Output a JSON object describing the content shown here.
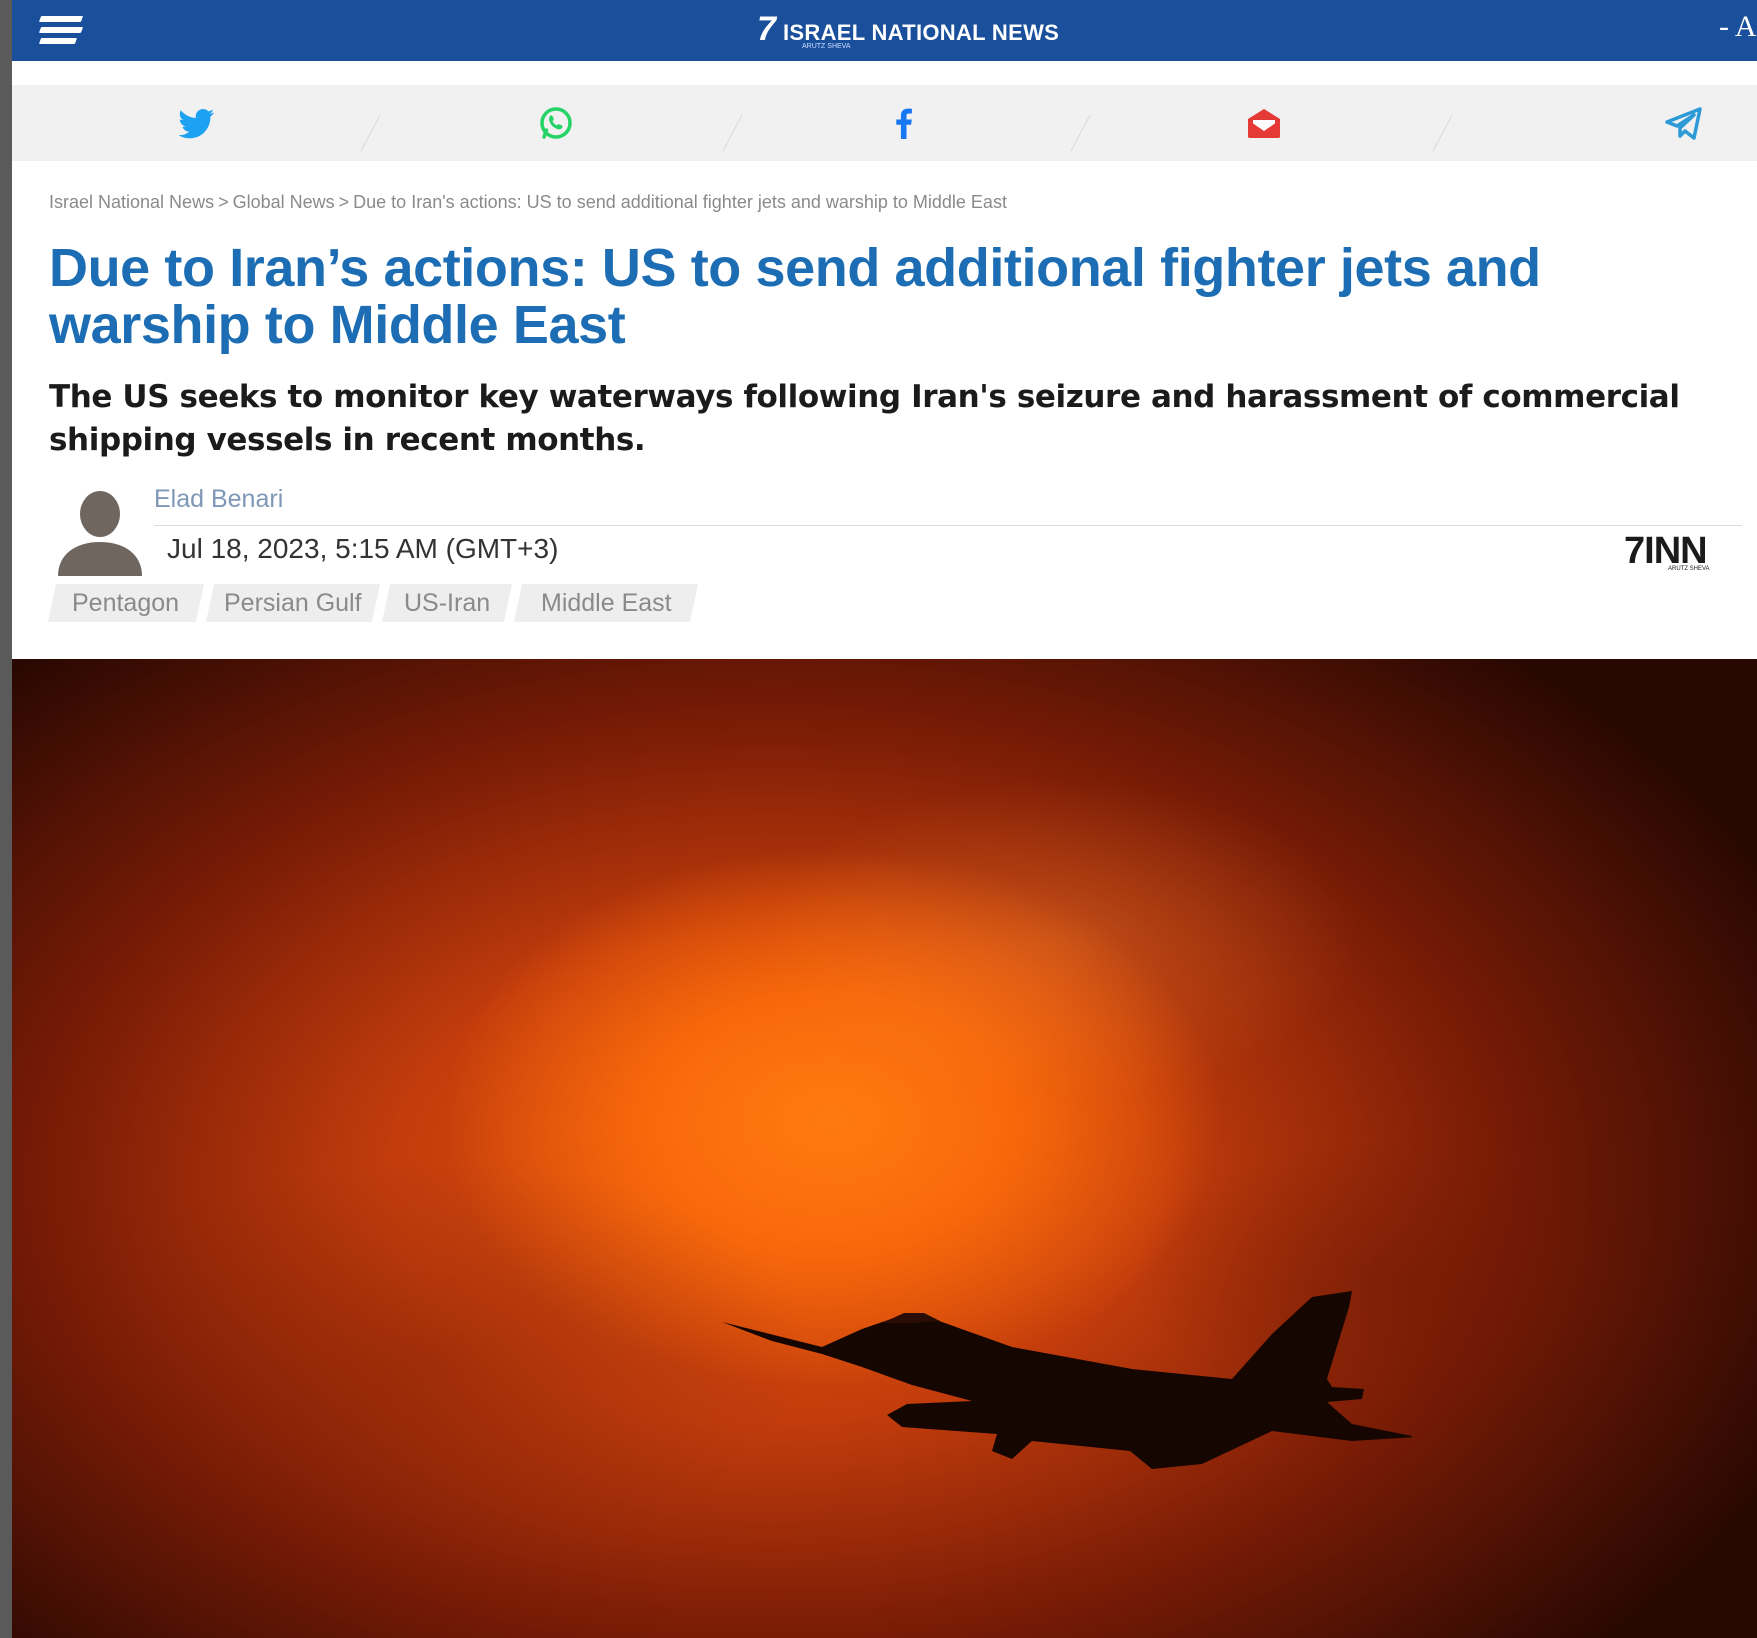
{
  "header": {
    "logo_mark": "7",
    "logo_text": "ISRAEL NATIONAL NEWS",
    "logo_subtext": "ARUTZ SHEVA",
    "font_size_control": "- A",
    "bar_color": "#1a4f9c"
  },
  "share": {
    "items": [
      {
        "name": "twitter-icon",
        "color": "#1da1f2"
      },
      {
        "name": "whatsapp-icon",
        "color": "#25d366"
      },
      {
        "name": "facebook-icon",
        "color": "#1877f2"
      },
      {
        "name": "email-icon",
        "color": "#e53935"
      },
      {
        "name": "telegram-icon",
        "color": "#2d9ad8"
      }
    ]
  },
  "breadcrumb": {
    "items": [
      "Israel National News",
      "Global News",
      "Due to Iran's actions: US to send additional fighter jets and warship to Middle East"
    ],
    "separator": ">"
  },
  "article": {
    "title": "Due to Iran’s actions: US to send additional fighter jets and warship to Middle East",
    "subtitle": "The US seeks to monitor key waterways following Iran's seizure and harassment of commercial shipping vessels in recent months.",
    "author": "Elad Benari",
    "date": "Jul 18, 2023, 5:15 AM (GMT+3)",
    "source_logo": "INN",
    "source_logo_mark": "7",
    "source_logo_sub": "ARUTZ SHEVA",
    "title_color": "#1c6db3"
  },
  "tags": [
    {
      "label": "Pentagon"
    },
    {
      "label": "Persian Gulf"
    },
    {
      "label": "US-Iran"
    },
    {
      "label": "Middle East"
    }
  ],
  "hero": {
    "subject": "fighter jet silhouette against orange sky"
  }
}
